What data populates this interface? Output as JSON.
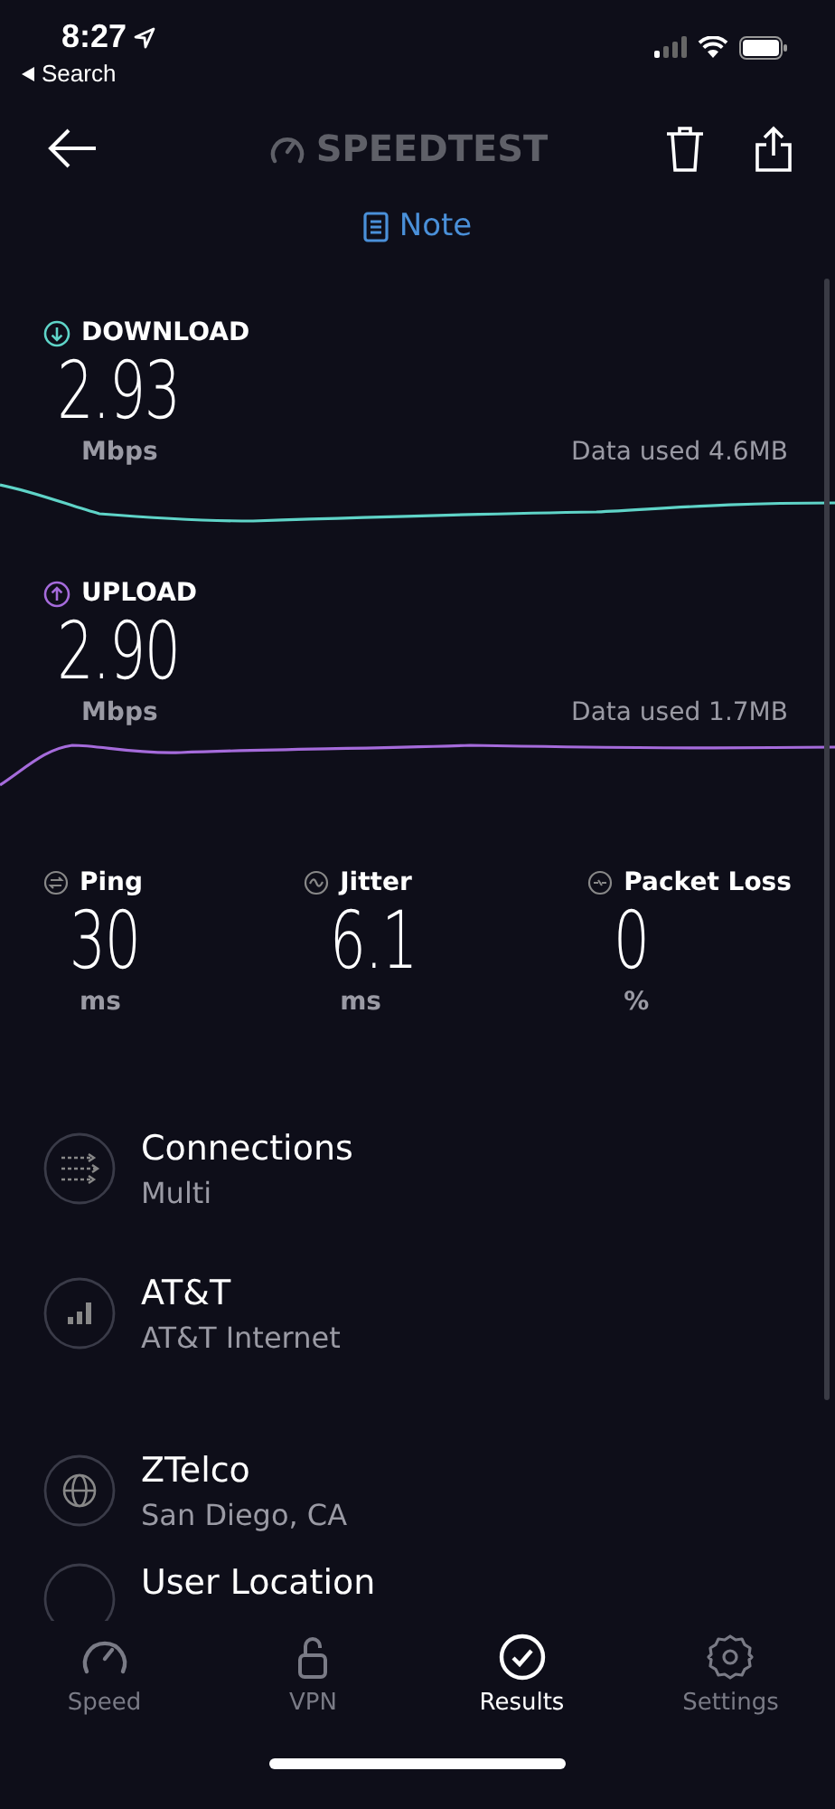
{
  "status_bar": {
    "time": "8:27",
    "back_label": "Search"
  },
  "header": {
    "logo": "SPEEDTEST",
    "note_label": "Note"
  },
  "results": [
    {
      "kind": "download",
      "label": "DOWNLOAD",
      "value": "2.93",
      "unit": "Mbps",
      "data_used": "Data used 4.6MB",
      "color": "#5fd4c8"
    },
    {
      "kind": "upload",
      "label": "UPLOAD",
      "value": "2.90",
      "unit": "Mbps",
      "data_used": "Data used 1.7MB",
      "color": "#a56bdb"
    }
  ],
  "metrics": [
    {
      "kind": "ping",
      "label": "Ping",
      "value": "30",
      "unit": "ms"
    },
    {
      "kind": "jitter",
      "label": "Jitter",
      "value": "6.1",
      "unit": "ms"
    },
    {
      "kind": "loss",
      "label": "Packet Loss",
      "value": "0",
      "unit": "%"
    }
  ],
  "details": [
    {
      "kind": "connections",
      "title": "Connections",
      "subtitle": "Multi"
    },
    {
      "kind": "provider",
      "title": "AT&T",
      "subtitle": "AT&T Internet"
    },
    {
      "kind": "server",
      "title": "ZTelco",
      "subtitle": "San Diego, CA"
    },
    {
      "kind": "location",
      "title": "User Location"
    }
  ],
  "tabs": [
    {
      "kind": "speed",
      "label": "Speed",
      "selected": false
    },
    {
      "kind": "vpn",
      "label": "VPN",
      "selected": false
    },
    {
      "kind": "results",
      "label": "Results",
      "selected": true
    },
    {
      "kind": "settings",
      "label": "Settings",
      "selected": false
    }
  ]
}
